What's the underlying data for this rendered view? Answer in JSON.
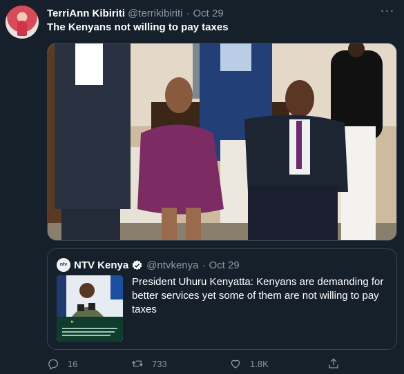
{
  "tweet": {
    "display_name": "TerriAnn Kibiriti",
    "handle": "@terrikibiriti",
    "separator": "·",
    "date": "Oct 29",
    "text": "The Kenyans not willing to pay taxes",
    "more_icon": "more-horizontal-icon"
  },
  "quoted": {
    "display_name": "NTV Kenya",
    "handle": "@ntvkenya",
    "separator": "·",
    "date": "Oct 29",
    "logo_text": "ntv",
    "text": "President Uhuru Kenyatta: Kenyans are demanding for better services yet some of them are not willing to pay taxes",
    "verified": true
  },
  "actions": {
    "reply_count": "16",
    "retweet_count": "733",
    "like_count": "1.8K"
  },
  "colors": {
    "background": "#15202b",
    "secondary_text": "#8899a6",
    "border": "#38444d",
    "verified_badge": "#ffffff"
  }
}
